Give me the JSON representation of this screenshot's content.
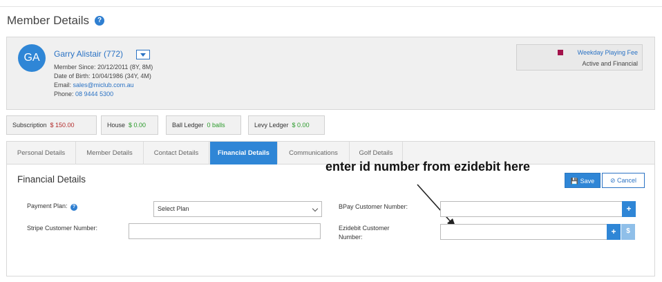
{
  "page": {
    "title": "Member Details",
    "help_icon": "?"
  },
  "member": {
    "initials": "GA",
    "name": "Garry Alistair (772)",
    "member_since": "Member Since: 20/12/2011 (8Y, 8M)",
    "dob": "Date of Birth: 10/04/1986 (34Y, 4M)",
    "email_label": "Email: ",
    "email": "sales@miclub.com.au",
    "phone_label": "Phone: ",
    "phone": "08 9444 5300",
    "fee_name": "Weekday Playing Fee",
    "fee_status": "Active and Financial",
    "fee_color": "#a3124b"
  },
  "ledgers": [
    {
      "label": "Subscription",
      "value": "$ 150.00",
      "color": "#b22a2a"
    },
    {
      "label": "House",
      "value": "$ 0.00",
      "color": "#2a9a2a"
    },
    {
      "label": "Ball Ledger",
      "value": "0 balls",
      "color": "#2a9a2a"
    },
    {
      "label": "Levy Ledger",
      "value": "$ 0.00",
      "color": "#2a9a2a"
    }
  ],
  "tabs": [
    {
      "label": "Personal Details"
    },
    {
      "label": "Member Details"
    },
    {
      "label": "Contact Details"
    },
    {
      "label": "Financial Details",
      "active": true
    },
    {
      "label": "Communications"
    },
    {
      "label": "Golf Details"
    }
  ],
  "financial": {
    "section_title": "Financial Details",
    "annotation": "enter id number from ezidebit here",
    "save_label": "Save",
    "cancel_label": "Cancel",
    "payment_plan_label": "Payment Plan:",
    "payment_plan_value": "Select Plan",
    "stripe_label": "Stripe Customer Number:",
    "stripe_value": "",
    "bpay_label": "BPay Customer Number:",
    "bpay_value": "",
    "ezidebit_label_1": "Ezidebit Customer",
    "ezidebit_label_2": "Number:",
    "ezidebit_value": "",
    "plus_glyph": "+",
    "dollar_glyph": "$"
  },
  "colors": {
    "accent": "#2f86d6",
    "link": "#2a72c4"
  }
}
